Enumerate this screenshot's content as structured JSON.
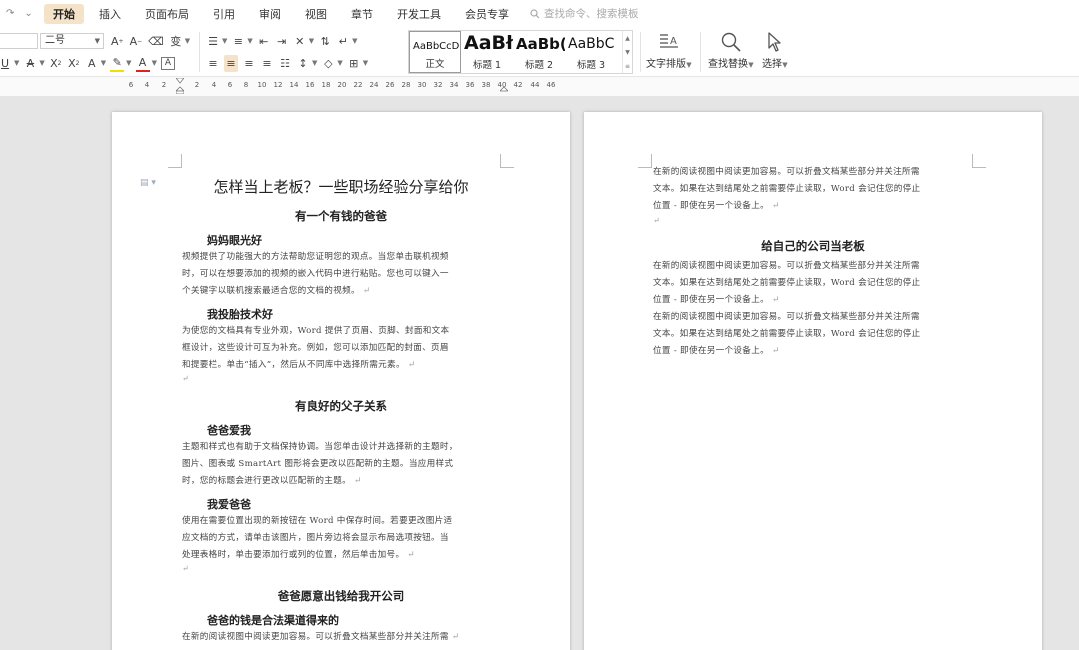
{
  "menu": {
    "tabs": [
      "开始",
      "插入",
      "页面布局",
      "引用",
      "审阅",
      "视图",
      "章节",
      "开发工具",
      "会员专享"
    ],
    "active_index": 0,
    "search_placeholder": "查找命令、搜索模板"
  },
  "ribbon": {
    "font_size_value": "二号",
    "styles": [
      {
        "preview": "AaBbCcDd",
        "label": "正文"
      },
      {
        "preview": "AaBł",
        "label": "标题 1"
      },
      {
        "preview": "AaBb(",
        "label": "标题 2"
      },
      {
        "preview": "AaBbC",
        "label": "标题 3"
      }
    ],
    "text_layout_label": "文字排版",
    "find_replace_label": "查找替换",
    "select_label": "选择"
  },
  "ruler": {
    "ticks": [
      "6",
      "4",
      "2",
      "2",
      "4",
      "6",
      "8",
      "10",
      "12",
      "14",
      "16",
      "18",
      "20",
      "22",
      "24",
      "26",
      "28",
      "30",
      "32",
      "34",
      "36",
      "38",
      "40",
      "42",
      "44",
      "46"
    ]
  },
  "page1": {
    "title": "怎样当上老板？一些职场经验分享给你",
    "sections": [
      {
        "heading": "有一个有钱的爸爸",
        "subs": [
          {
            "heading": "妈妈眼光好",
            "lines": [
              "视频提供了功能强大的方法帮助您证明您的观点。当您单击联机视频",
              "时，可以在想要添加的视频的嵌入代码中进行粘贴。您也可以键入一",
              "个关键字以联机搜索最适合您的文档的视频。"
            ]
          },
          {
            "heading": "我投胎技术好",
            "lines": [
              "为使您的文档具有专业外观，Word 提供了页眉、页脚、封面和文本",
              "框设计，这些设计可互为补充。例如，您可以添加匹配的封面、页眉",
              "和提要栏。单击“插入”，然后从不同库中选择所需元素。"
            ]
          }
        ]
      },
      {
        "heading": "有良好的父子关系",
        "subs": [
          {
            "heading": "爸爸爱我",
            "lines": [
              "主题和样式也有助于文档保持协调。当您单击设计并选择新的主题时，",
              "图片、图表或 SmartArt 图形将会更改以匹配新的主题。当应用样式",
              "时，您的标题会进行更改以匹配新的主题。"
            ]
          },
          {
            "heading": "我爱爸爸",
            "lines": [
              "使用在需要位置出现的新按钮在 Word 中保存时间。若要更改图片适",
              "应文档的方式，请单击该图片，图片旁边将会显示布局选项按钮。当",
              "处理表格时，单击要添加行或列的位置，然后单击加号。"
            ]
          }
        ]
      },
      {
        "heading": "爸爸愿意出钱给我开公司",
        "subs": [
          {
            "heading": "爸爸的钱是合法渠道得来的",
            "lines": [
              "在新的阅读视图中阅读更加容易。可以折叠文档某些部分并关注所需"
            ]
          }
        ]
      }
    ]
  },
  "page2": {
    "lines_top": [
      "在新的阅读视图中阅读更加容易。可以折叠文档某些部分并关注所需",
      "文本。如果在达到结尾处之前需要停止读取，Word 会记住您的停止",
      "位置 - 即使在另一个设备上。"
    ],
    "heading": "给自己的公司当老板",
    "lines_a": [
      "在新的阅读视图中阅读更加容易。可以折叠文档某些部分并关注所需",
      "文本。如果在达到结尾处之前需要停止读取，Word 会记住您的停止",
      "位置 - 即使在另一个设备上。"
    ],
    "lines_b": [
      "在新的阅读视图中阅读更加容易。可以折叠文档某些部分并关注所需",
      "文本。如果在达到结尾处之前需要停止读取，Word 会记住您的停止",
      "位置 - 即使在另一个设备上。"
    ]
  },
  "colors": {
    "active_tab_bg": "#f4e3c9",
    "canvas_bg": "#e5e5e5",
    "page_bg": "#ffffff"
  }
}
